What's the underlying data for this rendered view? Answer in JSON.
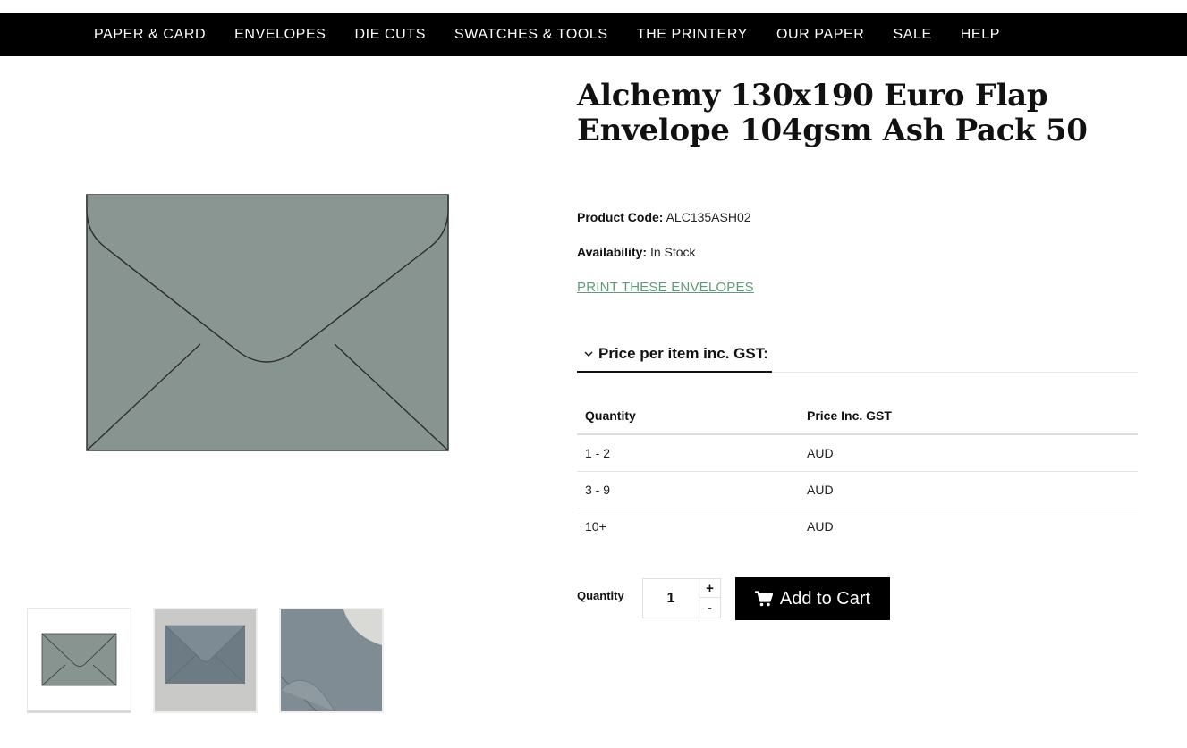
{
  "nav": {
    "items": [
      {
        "label": "PAPER & CARD"
      },
      {
        "label": "ENVELOPES"
      },
      {
        "label": "DIE CUTS"
      },
      {
        "label": "SWATCHES & TOOLS"
      },
      {
        "label": "THE PRINTERY"
      },
      {
        "label": "OUR PAPER"
      },
      {
        "label": "SALE"
      },
      {
        "label": "HELP"
      }
    ]
  },
  "product": {
    "title": "Alchemy 130x190 Euro Flap Envelope 104gsm Ash Pack 50",
    "code_label": "Product Code:",
    "code": "ALC135ASH02",
    "availability_label": "Availability:",
    "availability": "In Stock",
    "print_link": "PRINT THESE ENVELOPES",
    "envelope_color": "#889490"
  },
  "pricing": {
    "tab_label": "Price per item inc. GST:",
    "headers": [
      "Quantity",
      "Price Inc. GST"
    ],
    "rows": [
      {
        "quantity": "1 - 2",
        "price": "AUD"
      },
      {
        "quantity": "3 - 9",
        "price": "AUD"
      },
      {
        "quantity": "10+",
        "price": "AUD"
      }
    ]
  },
  "cart": {
    "quantity_label": "Quantity",
    "quantity_value": "1",
    "plus": "+",
    "minus": "-",
    "add_label": "Add to Cart"
  },
  "colors": {
    "nav_bg": "#000000",
    "link": "#5f9a7a",
    "button_bg": "#000000"
  }
}
